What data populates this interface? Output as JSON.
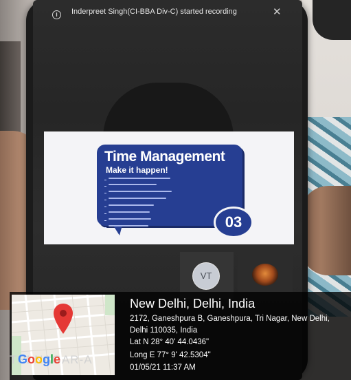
{
  "notification": {
    "icon": "info-icon",
    "text": "Inderpreet Singh(CI-BBA Div-C) started recording",
    "close_icon": "close-icon"
  },
  "slide": {
    "title": "Time Management",
    "subtitle": "Make it happen!",
    "bullet_count_note": "",
    "number": "03",
    "accent_color": "#263e92"
  },
  "participants": [
    {
      "initials": "VT"
    },
    {
      "initials": ""
    }
  ],
  "geo_stamp": {
    "place": "New Delhi, Delhi, India",
    "address": "2172, Ganeshpura B, Ganeshpura, Tri Nagar, New Delhi, Delhi 110035, India",
    "latitude": "Lat N 28° 40' 44.0436\"",
    "longitude": "Long E 77° 9' 42.5304\"",
    "datetime": "01/05/21 11:37 AM",
    "map_watermark": "TRI NAGAR-A",
    "map_logo": "Google",
    "pin_color": "#e53935"
  }
}
